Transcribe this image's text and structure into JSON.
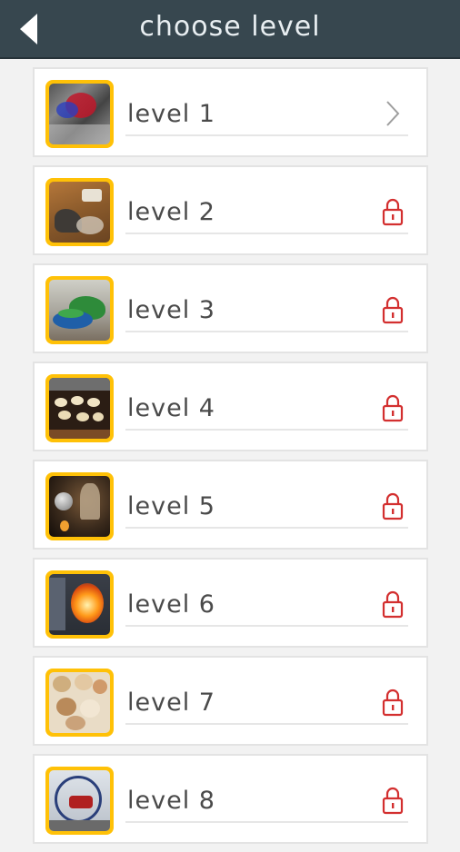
{
  "header": {
    "title": "choose level",
    "back_icon": "back-arrow-icon"
  },
  "colors": {
    "header_bg": "#37474f",
    "lock": "#d32f2f",
    "thumb_border": "#ffc107"
  },
  "levels": [
    {
      "label": "level 1",
      "status": "unlocked",
      "status_icon": "chevron-right-icon"
    },
    {
      "label": "level 2",
      "status": "locked",
      "status_icon": "lock-icon"
    },
    {
      "label": "level 3",
      "status": "locked",
      "status_icon": "lock-icon"
    },
    {
      "label": "level 4",
      "status": "locked",
      "status_icon": "lock-icon"
    },
    {
      "label": "level 5",
      "status": "locked",
      "status_icon": "lock-icon"
    },
    {
      "label": "level 6",
      "status": "locked",
      "status_icon": "lock-icon"
    },
    {
      "label": "level 7",
      "status": "locked",
      "status_icon": "lock-icon"
    },
    {
      "label": "level 8",
      "status": "locked",
      "status_icon": "lock-icon"
    }
  ]
}
